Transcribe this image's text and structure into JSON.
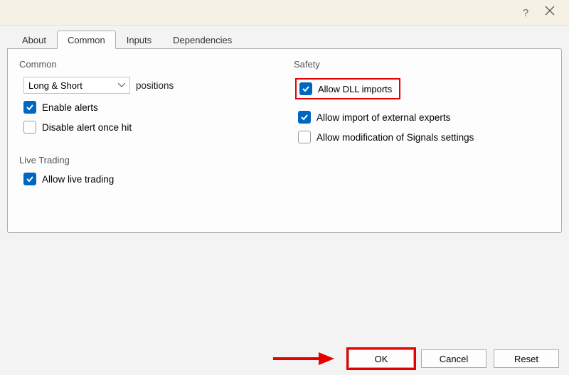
{
  "tabs": {
    "about": "About",
    "common": "Common",
    "inputs": "Inputs",
    "dependencies": "Dependencies"
  },
  "common_group": {
    "title": "Common",
    "positions_combo": "Long & Short",
    "positions_label": "positions",
    "enable_alerts": "Enable alerts",
    "disable_alert_once_hit": "Disable alert once hit"
  },
  "live_group": {
    "title": "Live Trading",
    "allow_live_trading": "Allow live trading"
  },
  "safety_group": {
    "title": "Safety",
    "allow_dll": "Allow DLL imports",
    "allow_external": "Allow import of external experts",
    "allow_signals_mod": "Allow modification of Signals settings"
  },
  "footer": {
    "ok": "OK",
    "cancel": "Cancel",
    "reset": "Reset"
  },
  "states": {
    "enable_alerts_checked": true,
    "disable_alert_once_checked": false,
    "allow_live_trading_checked": true,
    "allow_dll_checked": true,
    "allow_external_checked": true,
    "allow_signals_mod_checked": false
  }
}
